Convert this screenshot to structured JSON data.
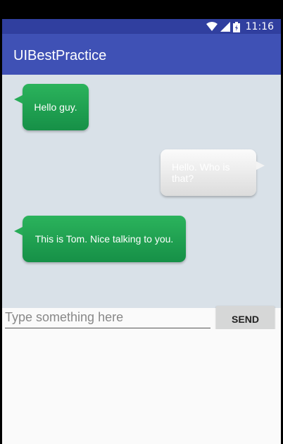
{
  "status_bar": {
    "time": "11:16"
  },
  "app_bar": {
    "title": "UIBestPractice"
  },
  "messages": [
    {
      "side": "received",
      "text": "Hello guy."
    },
    {
      "side": "sent",
      "text": "Hello. Who is that?"
    },
    {
      "side": "received",
      "text": "This is Tom. Nice talking to you."
    }
  ],
  "composer": {
    "placeholder": "Type something here",
    "value": "",
    "send_label": "SEND"
  },
  "colors": {
    "status_bar": "#303f9f",
    "app_bar": "#3f51b5",
    "chat_background": "#d9e1e8",
    "received_bubble": "#1fa04f",
    "sent_bubble": "#ececec"
  }
}
